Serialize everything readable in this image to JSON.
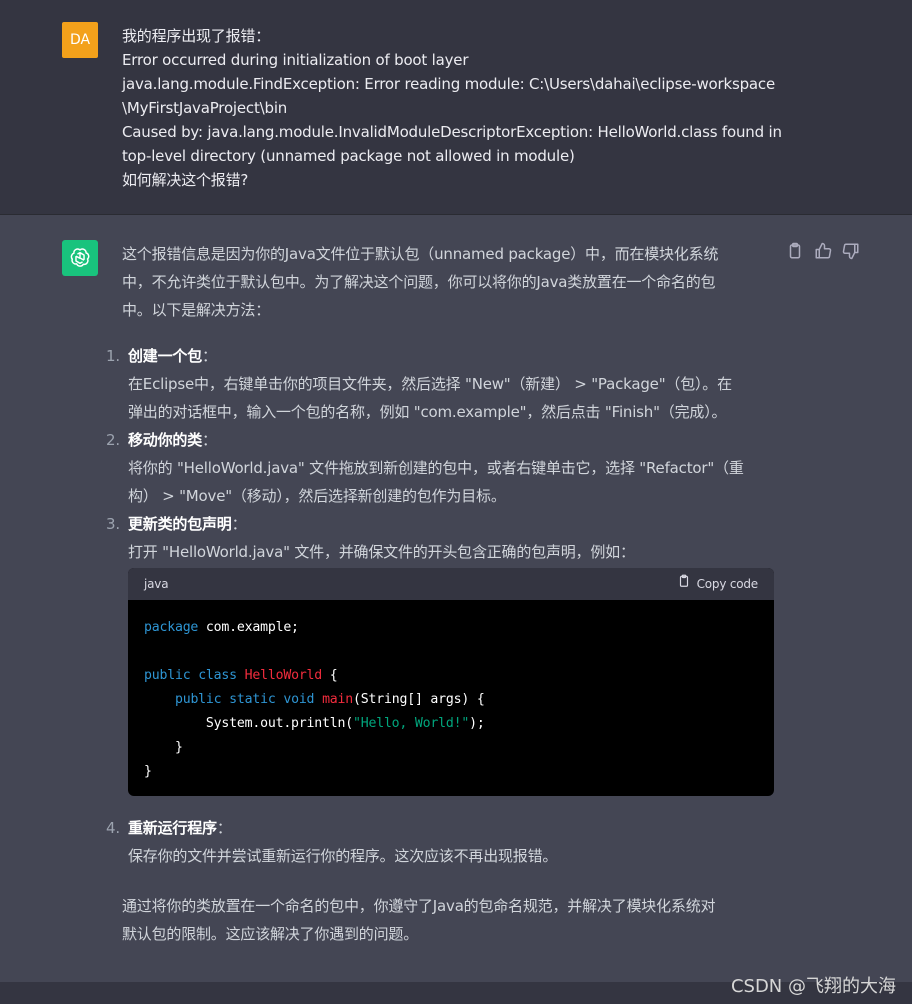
{
  "user": {
    "avatar_initials": "DA",
    "lines": [
      "我的程序出现了报错：",
      "Error occurred during initialization of boot layer",
      "java.lang.module.FindException: Error reading module: C:\\Users\\dahai\\eclipse-workspace",
      "\\MyFirstJavaProject\\bin",
      "Caused by: java.lang.module.InvalidModuleDescriptorException: HelloWorld.class found in",
      "top-level directory (unnamed package not allowed in module)",
      "如何解决这个报错?"
    ]
  },
  "assistant": {
    "intro": [
      "这个报错信息是因为你的Java文件位于默认包（unnamed package）中，而在模块化系统",
      "中，不允许类位于默认包中。为了解决这个问题，你可以将你的Java类放置在一个命名的包",
      "中。以下是解决方法："
    ],
    "steps": [
      {
        "num": "1.",
        "title": "创建一个包",
        "suffix": "：",
        "body": [
          "在Eclipse中，右键单击你的项目文件夹，然后选择 \"New\"（新建） > \"Package\"（包）。在",
          "弹出的对话框中，输入一个包的名称，例如 \"com.example\"，然后点击 \"Finish\"（完成）。"
        ]
      },
      {
        "num": "2.",
        "title": "移动你的类",
        "suffix": "：",
        "body": [
          "将你的 \"HelloWorld.java\" 文件拖放到新创建的包中，或者右键单击它，选择 \"Refactor\"（重",
          "构） > \"Move\"（移动），然后选择新创建的包作为目标。"
        ]
      },
      {
        "num": "3.",
        "title": "更新类的包声明",
        "suffix": "：",
        "body": [
          "打开 \"HelloWorld.java\" 文件，并确保文件的开头包含正确的包声明，例如："
        ]
      },
      {
        "num": "4.",
        "title": "重新运行程序",
        "suffix": "：",
        "body": [
          "保存你的文件并尝试重新运行你的程序。这次应该不再出现报错。"
        ]
      }
    ],
    "code": {
      "language": "java",
      "copy_label": "Copy code",
      "tokens": {
        "package_kw": "package",
        "package_name": " com.example;",
        "public1": "public",
        "class_kw": "class",
        "class_name": "HelloWorld",
        "open_brace": " {",
        "public2": "public",
        "static_kw": "static",
        "void_kw": "void",
        "method_name": "main",
        "params": "(String[] args) {",
        "print_call": "System.out.println(",
        "string_lit": "\"Hello, World!\"",
        "print_end": ");",
        "close_inner": "}",
        "close_outer": "}"
      }
    },
    "conclusion": [
      "通过将你的类放置在一个命名的包中，你遵守了Java的包命名规范，并解决了模块化系统对",
      "默认包的限制。这应该解决了你遇到的问题。"
    ]
  },
  "watermark": "CSDN @飞翔的大海",
  "icons": [
    "openai-logo-icon",
    "clipboard-icon",
    "thumbs-up-icon",
    "thumbs-down-icon"
  ],
  "colors": {
    "user_bg": "#343541",
    "assistant_bg": "#444654",
    "user_avatar": "#f3a11b",
    "bot_avatar": "#19c37d",
    "code_keyword": "#2e95d3",
    "code_class": "#f22c3d",
    "code_string": "#00a67d"
  }
}
